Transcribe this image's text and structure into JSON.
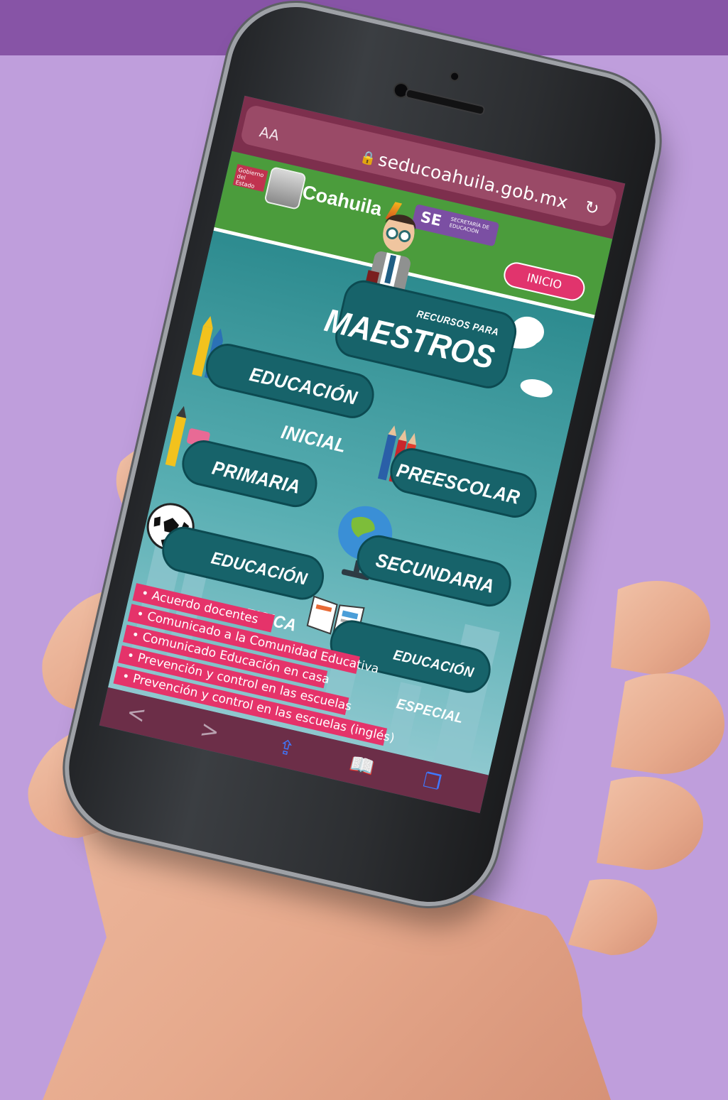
{
  "browser": {
    "text_size_label": "AA",
    "url": "seducoahuila.gob.mx",
    "reload_glyph": "↻",
    "lock_glyph": "🔒",
    "bottom_bar": {
      "back_glyph": "<",
      "forward_glyph": ">",
      "share_glyph": "⇪",
      "bookmarks_glyph": "📖",
      "tabs_glyph": "❐"
    }
  },
  "site": {
    "header": {
      "gobierno_badge": "Gobierno del Estado",
      "brand": "Coahuila",
      "se_badge": "SE",
      "se_subtitle": "SECRETARÍA DE EDUCACIÓN",
      "inicio_button": "INICIO"
    },
    "sections": {
      "maestros_small": "RECURSOS PARA",
      "maestros_big": "MAESTROS",
      "educacion_inicial": "EDUCACIÓN INICIAL",
      "preescolar": "PREESCOLAR",
      "primaria": "PRIMARIA",
      "secundaria": "SECUNDARIA",
      "educacion_fisica": "EDUCACIÓN FISICA",
      "educacion_especial": "EDUCACIÓN ESPECIAL"
    },
    "news": [
      "• Acuerdo docentes",
      "• Comunicado a la Comunidad Educativa",
      "• Comunicado Educación en casa",
      "• Prevención y control en las escuelas",
      "• Prevención y control en las escuelas (inglés)"
    ]
  },
  "colors": {
    "background": "#bf9edc",
    "top_band": "#8754a6",
    "browser_bar": "#7d2f4d",
    "site_header": "#4b9c3c",
    "section_pill": "#17636a",
    "news_bar": "#e5336a",
    "inicio_button": "#e1346d"
  }
}
